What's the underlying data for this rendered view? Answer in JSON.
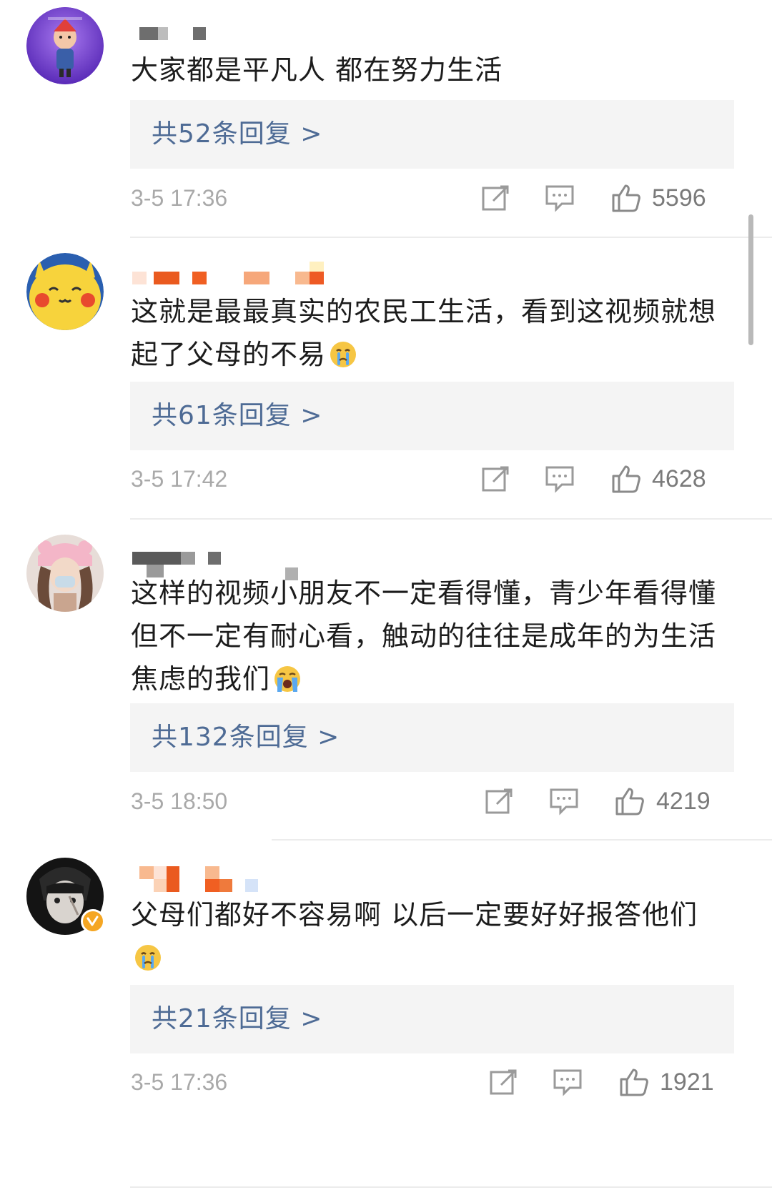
{
  "comments": [
    {
      "text": "大家都是平凡人 都在努力生活",
      "replies": "共52条回复 >",
      "time": "3-5 17:36",
      "likes": "5596",
      "emoji": ""
    },
    {
      "text": "这就是最最真实的农民工生活，看到这视频就想起了父母的不易",
      "replies": "共61条回复 >",
      "time": "3-5 17:42",
      "likes": "4628",
      "emoji": "crying-emoji"
    },
    {
      "text": "这样的视频小朋友不一定看得懂，青少年看得懂但不一定有耐心看，触动的往往是成年的为生活焦虑的我们",
      "replies": "共132条回复 >",
      "time": "3-5 18:50",
      "likes": "4219",
      "emoji": "loudly-crying-emoji"
    },
    {
      "text": "父母们都好不容易啊 以后一定要好好报答他们",
      "replies": "共21条回复 >",
      "time": "3-5 17:36",
      "likes": "1921",
      "emoji": "crying-emoji"
    }
  ],
  "icons": {
    "share": "share-icon",
    "comment": "comment-icon",
    "like": "thumbs-up-icon",
    "verified": "verified-badge-icon"
  },
  "colors": {
    "reply_link": "#4e6b95",
    "reply_bg": "#f4f4f4",
    "meta_text": "#a9a9a9",
    "verified_badge": "#f5a623"
  }
}
